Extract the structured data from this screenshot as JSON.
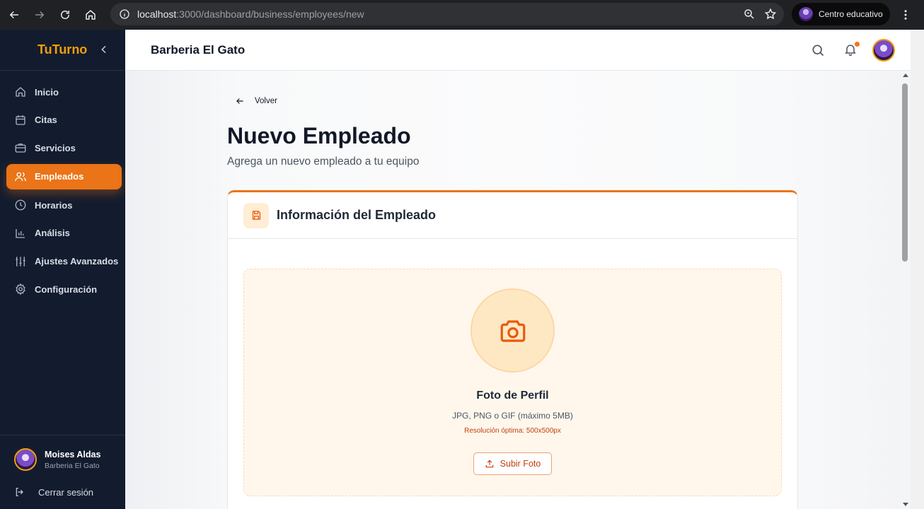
{
  "browser": {
    "url_host": "localhost",
    "url_rest": ":3000/dashboard/business/employees/new",
    "profile_label": "Centro educativo"
  },
  "sidebar": {
    "brand": "TuTurno",
    "items": [
      {
        "label": "Inicio",
        "icon": "home-icon",
        "active": false
      },
      {
        "label": "Citas",
        "icon": "calendar-icon",
        "active": false
      },
      {
        "label": "Servicios",
        "icon": "briefcase-icon",
        "active": false
      },
      {
        "label": "Empleados",
        "icon": "users-icon",
        "active": true
      },
      {
        "label": "Horarios",
        "icon": "clock-icon",
        "active": false
      },
      {
        "label": "Análisis",
        "icon": "bar-chart-icon",
        "active": false
      },
      {
        "label": "Ajustes Avanzados",
        "icon": "sliders-icon",
        "active": false
      },
      {
        "label": "Configuración",
        "icon": "gear-icon",
        "active": false
      }
    ],
    "user": {
      "name": "Moises Aldas",
      "business": "Barberia El Gato"
    },
    "logout_label": "Cerrar sesión"
  },
  "header": {
    "business_name": "Barberia El Gato"
  },
  "main": {
    "back_label": "Volver",
    "title": "Nuevo Empleado",
    "subtitle": "Agrega un nuevo empleado a tu equipo",
    "card": {
      "title": "Información del Empleado",
      "photo": {
        "title": "Foto de Perfil",
        "formats": "JPG, PNG o GIF (máximo 5MB)",
        "resolution": "Resolución óptima: 500x500px",
        "button_label": "Subir Foto"
      }
    }
  },
  "colors": {
    "accent": "#ea7417",
    "sidebar_bg": "#131c2e",
    "brand": "#f59e0b"
  }
}
